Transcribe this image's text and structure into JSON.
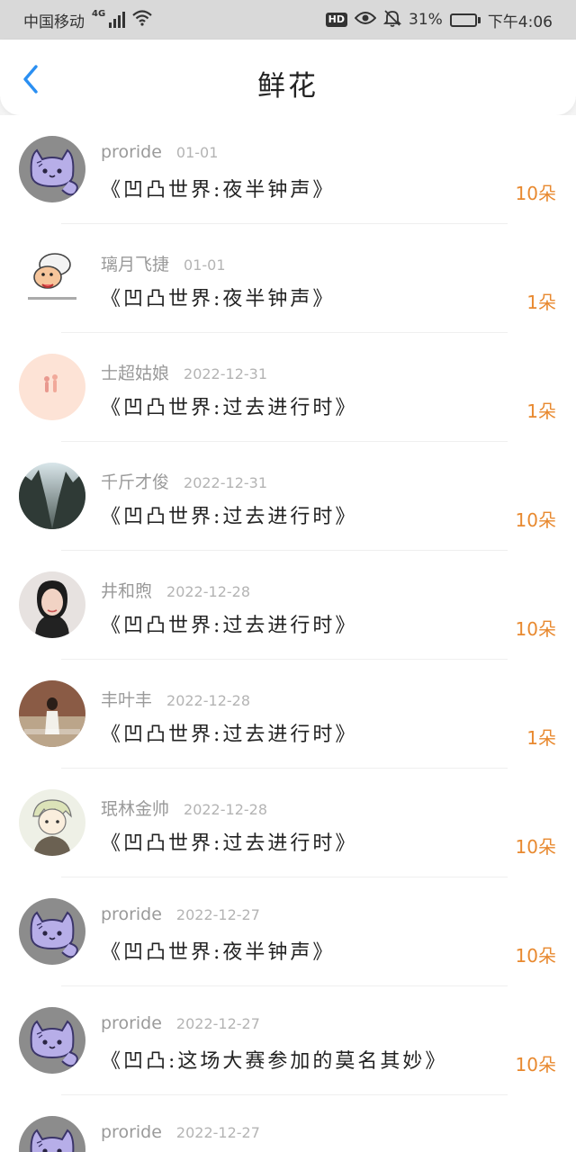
{
  "status_bar": {
    "carrier": "中国移动",
    "network": "4G",
    "hd": "HD",
    "battery_percent": "31%",
    "battery_level": 0.31,
    "time": "下午4:06"
  },
  "header": {
    "title": "鲜花",
    "back_icon": "chevron-left-icon",
    "accent": "#2a8ff2"
  },
  "flowers_color": "#e8892f",
  "rows": [
    {
      "user": "proride",
      "date": "01-01",
      "book": "《凹凸世界:夜半钟声》",
      "count": "10朵",
      "avatar": "cat"
    },
    {
      "user": "璃月飞捷",
      "date": "01-01",
      "book": "《凹凸世界:夜半钟声》",
      "count": "1朵",
      "avatar": "cartoon"
    },
    {
      "user": "士超姑娘",
      "date": "2022-12-31",
      "book": "《凹凸世界:过去进行时》",
      "count": "1朵",
      "avatar": "peach"
    },
    {
      "user": "千斤才俊",
      "date": "2022-12-31",
      "book": "《凹凸世界:过去进行时》",
      "count": "10朵",
      "avatar": "forest"
    },
    {
      "user": "井和煦",
      "date": "2022-12-28",
      "book": "《凹凸世界:过去进行时》",
      "count": "10朵",
      "avatar": "portrait"
    },
    {
      "user": "丰叶丰",
      "date": "2022-12-28",
      "book": "《凹凸世界:过去进行时》",
      "count": "1朵",
      "avatar": "photo"
    },
    {
      "user": "珉林金帅",
      "date": "2022-12-28",
      "book": "《凹凸世界:过去进行时》",
      "count": "10朵",
      "avatar": "anime"
    },
    {
      "user": "proride",
      "date": "2022-12-27",
      "book": "《凹凸世界:夜半钟声》",
      "count": "10朵",
      "avatar": "cat"
    },
    {
      "user": "proride",
      "date": "2022-12-27",
      "book": "《凹凸:这场大赛参加的莫名其妙》",
      "count": "10朵",
      "avatar": "cat"
    },
    {
      "user": "proride",
      "date": "2022-12-27",
      "book": "",
      "count": "",
      "avatar": "cat"
    }
  ]
}
